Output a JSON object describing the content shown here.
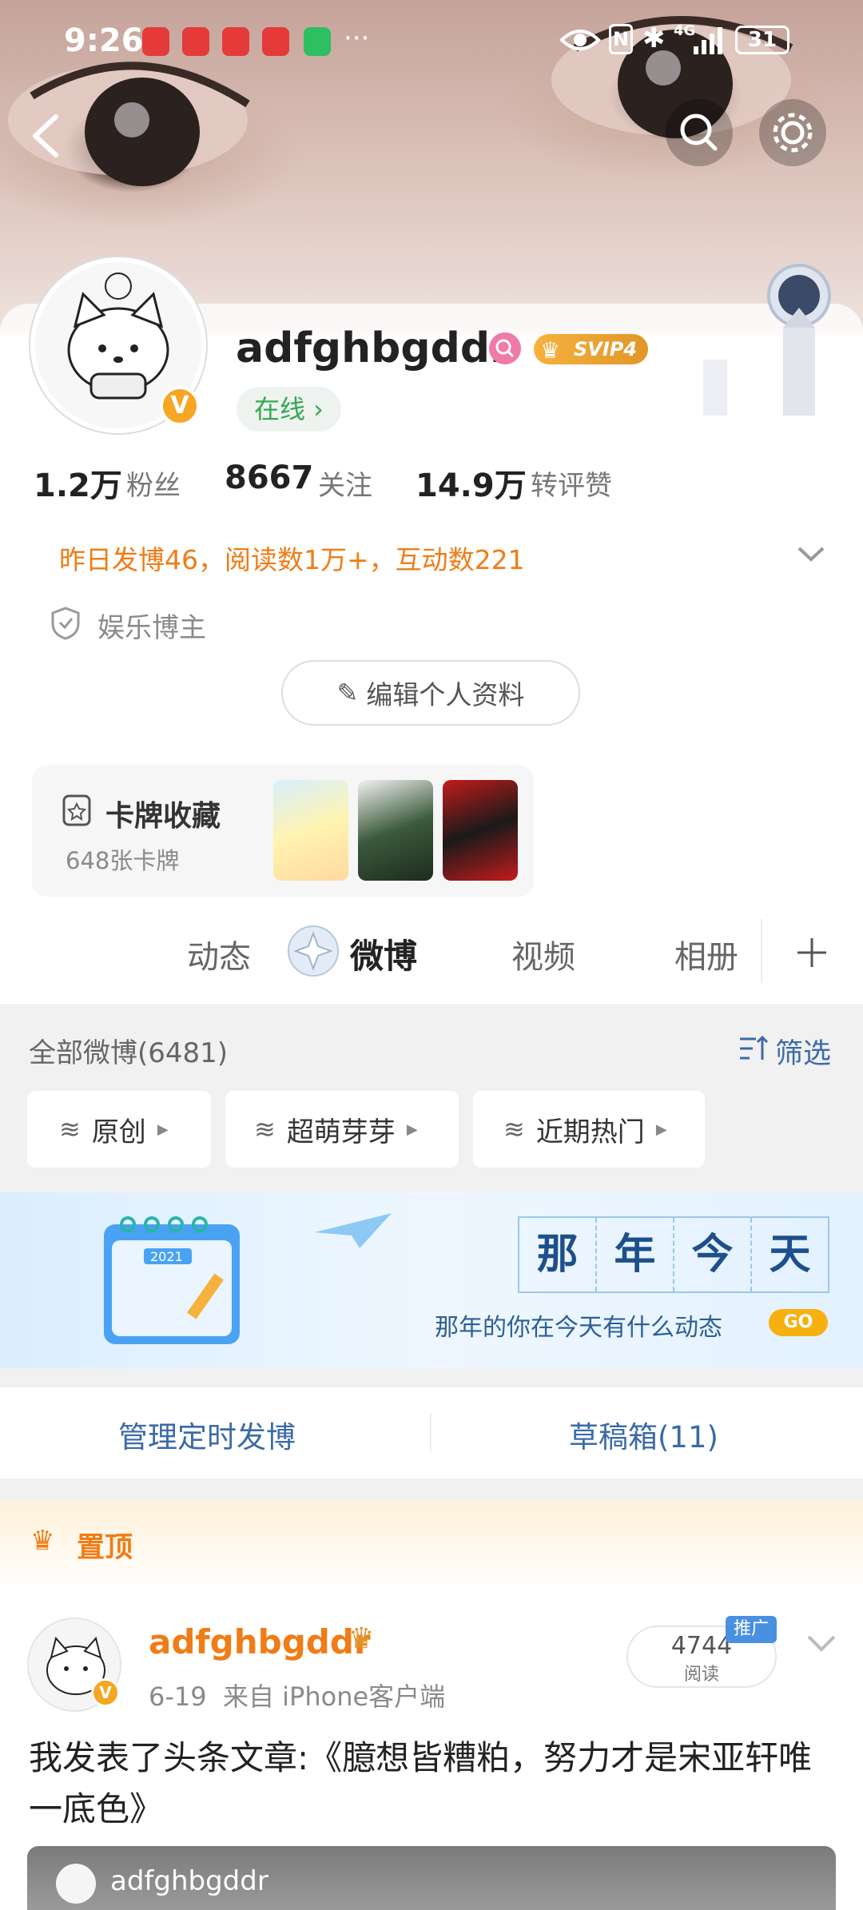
{
  "status": {
    "time": "9:26",
    "dots": "···",
    "network": "4G",
    "battery": "31"
  },
  "profile": {
    "username": "adfghbgddr",
    "vip": "SVIP4",
    "online": "在线 ›",
    "stats": [
      {
        "num": "1.2万",
        "label": "粉丝"
      },
      {
        "num": "8667",
        "label": "关注"
      },
      {
        "num": "14.9万",
        "label": "转评赞"
      }
    ],
    "activity": "昨日发博46，阅读数1万+，互动数221",
    "tag": "娱乐博主",
    "edit_label": "编辑个人资料"
  },
  "cards": {
    "title": "卡牌收藏",
    "count": "648张卡牌"
  },
  "tabs": [
    "动态",
    "微博",
    "视频",
    "相册"
  ],
  "filter": {
    "title": "全部微博(6481)",
    "filter_label": "筛选",
    "buttons": [
      "原创",
      "超萌芽芽",
      "近期热门"
    ]
  },
  "banner": {
    "chars": [
      "那",
      "年",
      "今",
      "天"
    ],
    "subtitle": "那年的你在今天有什么动态",
    "go": "GO",
    "calendar_year": "2021"
  },
  "tools": {
    "scheduled": "管理定时发博",
    "drafts": "草稿箱(11)"
  },
  "post": {
    "pinned": "置顶",
    "author": "adfghbgddr",
    "meta": "6-19  来自 iPhone客户端",
    "reads": "4744",
    "reads_label": "阅读",
    "promo": "推广",
    "content": "我发表了头条文章:《臆想皆糟粕，努力才是宋亚轩唯一底色》",
    "quote_author": "adfghbgddr"
  },
  "colors": {
    "accent_orange": "#f07c16",
    "green": "#33a853",
    "link_blue": "#3b6aa8"
  }
}
